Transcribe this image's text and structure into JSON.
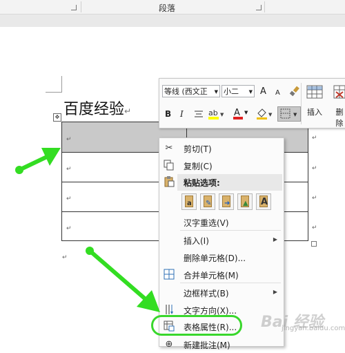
{
  "ribbon": {
    "group_label": "段落"
  },
  "document": {
    "title": "百度经验",
    "paragraph_mark": "↵",
    "move_handle_icon": "move-cross-icon"
  },
  "mini_toolbar": {
    "font_name": "等线 (西文正",
    "font_size": "小二",
    "grow_font": "A",
    "shrink_font": "A",
    "bold": "B",
    "italic": "I",
    "font_color": "A",
    "insert_label": "插入",
    "delete_label": "删除"
  },
  "context_menu": {
    "items": [
      {
        "label": "剪切(T)",
        "icon": "scissors-icon"
      },
      {
        "label": "复制(C)",
        "icon": "copy-icon"
      },
      {
        "label": "粘贴选项:",
        "icon": "paste-icon"
      },
      {
        "label": "汉字重选(V)",
        "icon": ""
      },
      {
        "label": "插入(I)",
        "icon": ""
      },
      {
        "label": "删除单元格(D)...",
        "icon": ""
      },
      {
        "label": "合并单元格(M)",
        "icon": "merge-cells-icon"
      },
      {
        "label": "边框样式(B)",
        "icon": ""
      },
      {
        "label": "文字方向(X)...",
        "icon": "text-direction-icon"
      },
      {
        "label": "表格属性(R)...",
        "icon": "table-properties-icon"
      },
      {
        "label": "新建批注(M)",
        "icon": "new-comment-icon"
      }
    ],
    "paste_options": [
      "A"
    ]
  },
  "watermark": {
    "brand": "Bai 经验",
    "url": "jingyan.baidu.com"
  },
  "annotation": {
    "arrow_color": "#33dd22",
    "highlight_color": "#39d72c"
  }
}
